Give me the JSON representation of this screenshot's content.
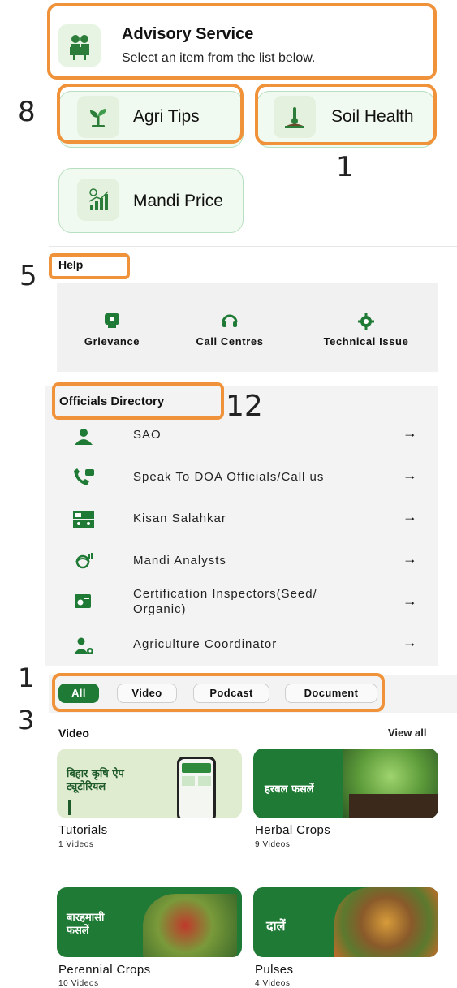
{
  "advisory": {
    "title": "Advisory Service",
    "subtitle": "Select an item from the list below.",
    "icon": "advisor-desk-icon",
    "items": [
      {
        "label": "Agri Tips",
        "icon": "sprout-icon"
      },
      {
        "label": "Soil Health",
        "icon": "soil-thermometer-icon"
      },
      {
        "label": "Mandi Price",
        "icon": "price-chart-icon"
      }
    ]
  },
  "annotations": {
    "agri_tips": "8",
    "soil_health": "1",
    "help": "5",
    "officials": "12",
    "filters_top": "1",
    "filters_bottom": "3"
  },
  "help": {
    "title": "Help",
    "items": [
      {
        "label": "Grievance",
        "icon": "grievance-icon"
      },
      {
        "label": "Call Centres",
        "icon": "headset-icon"
      },
      {
        "label": "Technical Issue",
        "icon": "gear-icon"
      }
    ]
  },
  "directory": {
    "title": "Officials Directory",
    "arrow": "→",
    "rows": [
      {
        "label": "SAO",
        "icon": "officer-icon"
      },
      {
        "label": "Speak To DOA Officials/Call us",
        "icon": "phone-icon"
      },
      {
        "label": "Kisan Salahkar",
        "icon": "advisor-icon"
      },
      {
        "label": "Mandi Analysts",
        "icon": "analyst-icon"
      },
      {
        "label": "Certification Inspectors(Seed/",
        "label2": "Organic)",
        "icon": "certificate-icon"
      },
      {
        "label": "Agriculture Coordinator",
        "icon": "coordinator-icon"
      }
    ]
  },
  "filters": {
    "chips": [
      "All",
      "Video",
      "Podcast",
      "Document"
    ],
    "active": "All"
  },
  "video": {
    "heading": "Video",
    "view_all": "View all",
    "items": [
      {
        "title": "Tutorials",
        "count": "1 Videos",
        "thumb_text_1": "बिहार कृषि ऐप",
        "thumb_text_2": "ट्यूटोरियल"
      },
      {
        "title": "Herbal Crops",
        "count": "9 Videos",
        "thumb_text_1": "हरबल फसलें",
        "thumb_text_2": ""
      },
      {
        "title": "Perennial Crops",
        "count": "10 Videos",
        "thumb_text_1": "बारहमासी",
        "thumb_text_2": "फसलें"
      },
      {
        "title": "Pulses",
        "count": "4 Videos",
        "thumb_text_1": "दालें",
        "thumb_text_2": ""
      }
    ]
  },
  "colors": {
    "highlight": "#f0923a",
    "primary_green": "#1f7a35",
    "card_bg": "#f1faf0"
  }
}
